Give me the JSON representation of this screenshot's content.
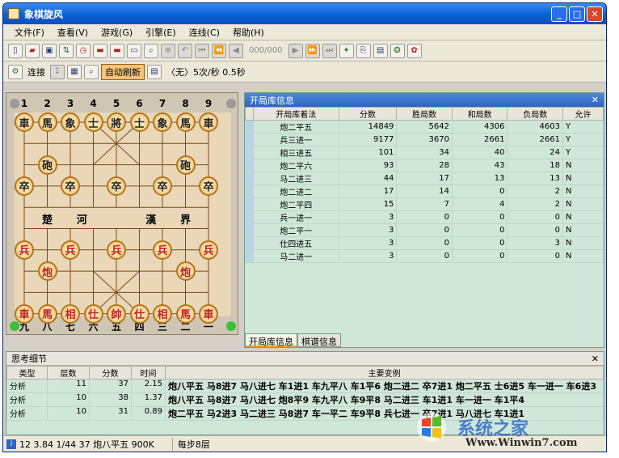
{
  "window": {
    "title": "象棋旋风"
  },
  "menu": [
    "文件(F)",
    "查看(V)",
    "游戏(G)",
    "引擎(E)",
    "连线(C)",
    "帮助(H)"
  ],
  "toolbar": {
    "counter": "000/000"
  },
  "toolbar2": {
    "connect": "连接",
    "auto_refresh": "自动刷新",
    "info": "〈无〉5次/秒 0.5秒"
  },
  "board": {
    "top_numbers": [
      "1",
      "2",
      "3",
      "4",
      "5",
      "6",
      "7",
      "8",
      "9"
    ],
    "bottom_numbers": [
      "九",
      "八",
      "七",
      "六",
      "五",
      "四",
      "三",
      "二",
      "一"
    ],
    "river": [
      "楚",
      "河",
      "漢",
      "界"
    ],
    "pieces": [
      {
        "t": "車",
        "c": "black",
        "col": 0,
        "row": 0
      },
      {
        "t": "馬",
        "c": "black",
        "col": 1,
        "row": 0
      },
      {
        "t": "象",
        "c": "black",
        "col": 2,
        "row": 0
      },
      {
        "t": "士",
        "c": "black",
        "col": 3,
        "row": 0
      },
      {
        "t": "將",
        "c": "black",
        "col": 4,
        "row": 0
      },
      {
        "t": "士",
        "c": "black",
        "col": 5,
        "row": 0
      },
      {
        "t": "象",
        "c": "black",
        "col": 6,
        "row": 0
      },
      {
        "t": "馬",
        "c": "black",
        "col": 7,
        "row": 0
      },
      {
        "t": "車",
        "c": "black",
        "col": 8,
        "row": 0
      },
      {
        "t": "砲",
        "c": "black",
        "col": 1,
        "row": 2
      },
      {
        "t": "砲",
        "c": "black",
        "col": 7,
        "row": 2
      },
      {
        "t": "卒",
        "c": "black",
        "col": 0,
        "row": 3
      },
      {
        "t": "卒",
        "c": "black",
        "col": 2,
        "row": 3
      },
      {
        "t": "卒",
        "c": "black",
        "col": 4,
        "row": 3
      },
      {
        "t": "卒",
        "c": "black",
        "col": 6,
        "row": 3
      },
      {
        "t": "卒",
        "c": "black",
        "col": 8,
        "row": 3
      },
      {
        "t": "兵",
        "c": "red",
        "col": 0,
        "row": 6
      },
      {
        "t": "兵",
        "c": "red",
        "col": 2,
        "row": 6
      },
      {
        "t": "兵",
        "c": "red",
        "col": 4,
        "row": 6
      },
      {
        "t": "兵",
        "c": "red",
        "col": 6,
        "row": 6
      },
      {
        "t": "兵",
        "c": "red",
        "col": 8,
        "row": 6
      },
      {
        "t": "炮",
        "c": "red",
        "col": 1,
        "row": 7
      },
      {
        "t": "炮",
        "c": "red",
        "col": 7,
        "row": 7
      },
      {
        "t": "車",
        "c": "red",
        "col": 0,
        "row": 9
      },
      {
        "t": "馬",
        "c": "red",
        "col": 1,
        "row": 9
      },
      {
        "t": "相",
        "c": "red",
        "col": 2,
        "row": 9
      },
      {
        "t": "仕",
        "c": "red",
        "col": 3,
        "row": 9
      },
      {
        "t": "帥",
        "c": "red",
        "col": 4,
        "row": 9
      },
      {
        "t": "仕",
        "c": "red",
        "col": 5,
        "row": 9
      },
      {
        "t": "相",
        "c": "red",
        "col": 6,
        "row": 9
      },
      {
        "t": "馬",
        "c": "red",
        "col": 7,
        "row": 9
      },
      {
        "t": "車",
        "c": "red",
        "col": 8,
        "row": 9
      }
    ]
  },
  "book": {
    "title": "开局库信息",
    "headers": [
      "开局库着法",
      "分数",
      "胜局数",
      "和局数",
      "负局数",
      "允许"
    ],
    "rows": [
      [
        "炮二平五",
        "14849",
        "5642",
        "4306",
        "4603",
        "Y"
      ],
      [
        "兵三进一",
        "9177",
        "3670",
        "2661",
        "2661",
        "Y"
      ],
      [
        "相三进五",
        "101",
        "34",
        "40",
        "24",
        "Y"
      ],
      [
        "炮二平六",
        "93",
        "28",
        "43",
        "18",
        "N"
      ],
      [
        "马二进三",
        "44",
        "17",
        "13",
        "13",
        "N"
      ],
      [
        "炮二进二",
        "17",
        "14",
        "0",
        "2",
        "N"
      ],
      [
        "炮二平四",
        "15",
        "7",
        "4",
        "2",
        "N"
      ],
      [
        "兵一进一",
        "3",
        "0",
        "0",
        "0",
        "N"
      ],
      [
        "炮二平一",
        "3",
        "0",
        "0",
        "0",
        "N"
      ],
      [
        "仕四进五",
        "3",
        "0",
        "0",
        "3",
        "N"
      ],
      [
        "马二进一",
        "3",
        "0",
        "0",
        "0",
        "N"
      ]
    ],
    "tabs": [
      "开局库信息",
      "棋谱信息"
    ]
  },
  "think": {
    "title": "思考细节",
    "headers": [
      "类型",
      "层数",
      "分数",
      "时间",
      "主要变例"
    ],
    "rows": [
      [
        "分析",
        "11",
        "37",
        "2.15",
        "炮八平五 马8进7 马八进七 车1进1 车九平八 车1平6 炮二进二 卒7进1 炮二平五 士6进5 车一进一 车6进3"
      ],
      [
        "分析",
        "10",
        "38",
        "1.37",
        "炮八平五 马8进7 马八进七 炮8平9 车九平八 车9平8 马二进三 车1进1 车一进一 车1平4"
      ],
      [
        "分析",
        "10",
        "31",
        "0.89",
        "炮二平五 马2进3 马二进三 马8进7 车一平二 车9平8 兵七进一 卒7进1 马八进七 车1进1"
      ]
    ]
  },
  "status": {
    "left": "12 3.84 1/44 37 炮八平五 900K",
    "right": "每步8层"
  },
  "watermark": {
    "brand": "系统之家",
    "url": "Www.Winwin7.com"
  }
}
